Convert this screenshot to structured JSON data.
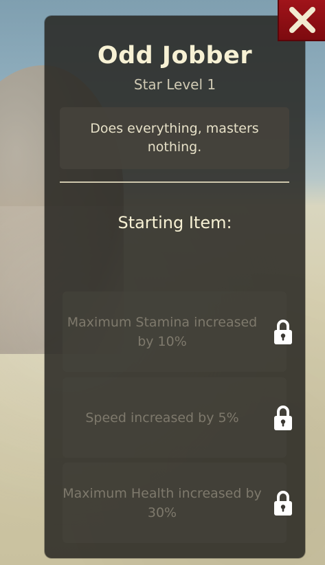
{
  "close_button": {
    "icon": "close-icon"
  },
  "panel": {
    "title": "Odd Jobber",
    "subtitle": "Star Level 1",
    "description": "Does everything, masters nothing.",
    "starting_item_label": "Starting Item:"
  },
  "perks": [
    {
      "text": "Maximum Stamina increased by 10%",
      "locked": true,
      "icon": "lock-icon"
    },
    {
      "text": "Speed increased by 5%",
      "locked": true,
      "icon": "lock-icon"
    },
    {
      "text": "Maximum Health increased by 30%",
      "locked": true,
      "icon": "lock-icon"
    }
  ],
  "colors": {
    "close_button_red": "#8e0f15",
    "title_cream": "#f7f1d4",
    "panel_dark": "#282622",
    "locked_text": "#7e796c"
  }
}
